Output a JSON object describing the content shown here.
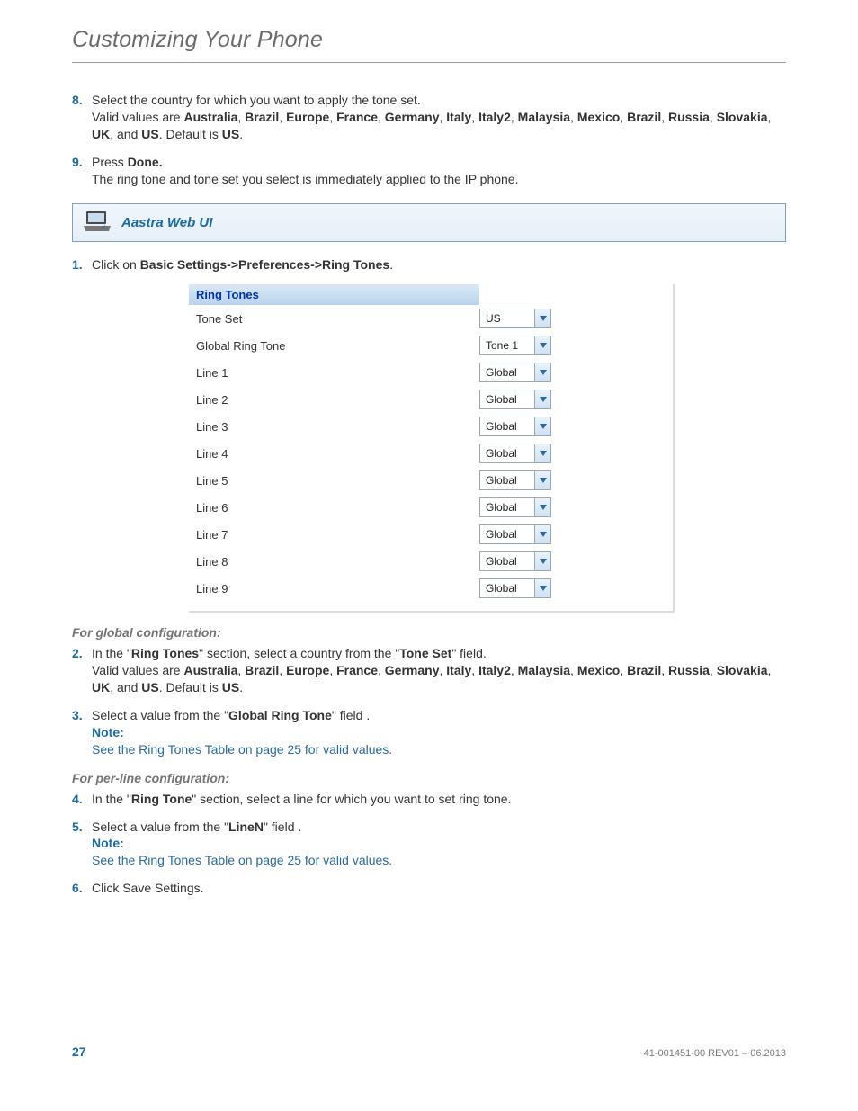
{
  "header": {
    "title": "Customizing Your Phone"
  },
  "topSteps": [
    {
      "num": "8.",
      "lead": "Select the country for which you want to apply the tone set.",
      "valid_prefix": "Valid values are ",
      "values": [
        "Australia",
        "Brazil",
        "Europe",
        "France",
        "Germany",
        "Italy",
        "Italy2",
        "Malaysia",
        "Mexico",
        "Brazil",
        "Russia",
        "Slovakia",
        "UK",
        "US"
      ],
      "valid_mid": ", and ",
      "valid_suffix": ". Default is ",
      "default": "US",
      "end": "."
    },
    {
      "num": "9.",
      "press_prefix": "Press ",
      "press_bold": "Done.",
      "after": "The ring tone and tone set you select is immediately applied to the IP phone."
    }
  ],
  "section": {
    "title": "Aastra Web UI"
  },
  "step1": {
    "num": "1.",
    "prefix": "Click on ",
    "bold": "Basic Settings->Preferences->Ring Tones",
    "suffix": "."
  },
  "ui": {
    "title": "Ring Tones",
    "rows": [
      {
        "label": "Tone Set",
        "value": "US"
      },
      {
        "label": "Global Ring Tone",
        "value": "Tone 1"
      },
      {
        "label": "Line 1",
        "value": "Global"
      },
      {
        "label": "Line 2",
        "value": "Global"
      },
      {
        "label": "Line 3",
        "value": "Global"
      },
      {
        "label": "Line 4",
        "value": "Global"
      },
      {
        "label": "Line 5",
        "value": "Global"
      },
      {
        "label": "Line 6",
        "value": "Global"
      },
      {
        "label": "Line 7",
        "value": "Global"
      },
      {
        "label": "Line 8",
        "value": "Global"
      },
      {
        "label": "Line 9",
        "value": "Global"
      }
    ]
  },
  "globalHeading": "For global configuration:",
  "step2": {
    "num": "2.",
    "t1": "In the \"",
    "b1": "Ring Tones",
    "t2": "\" section, select a country from the \"",
    "b2": "Tone Set",
    "t3": "\" field.",
    "valid_prefix": "Valid values are ",
    "values": [
      "Australia",
      "Brazil",
      "Europe",
      "France",
      "Germany",
      "Italy",
      "Italy2",
      "Malaysia",
      "Mexico",
      "Brazil",
      "Russia",
      "Slovakia",
      "UK",
      "US"
    ],
    "valid_mid": ", and ",
    "valid_suffix": ". Default is ",
    "default": "US",
    "end": "."
  },
  "step3": {
    "num": "3.",
    "t1": "Select a value from the \"",
    "b1": "Global Ring Tone",
    "t2": "\" field .",
    "note_label": "Note:",
    "note_t1": "See the ",
    "note_link": "Ring Tones Table",
    "note_t2": " on ",
    "note_page": "page 25",
    "note_t3": " for valid values."
  },
  "perLineHeading": "For per-line configuration:",
  "step4": {
    "num": "4.",
    "t1": "In the \"",
    "b1": "Ring Tone",
    "t2": "\" section, select a line for which you want to set ring tone."
  },
  "step5": {
    "num": "5.",
    "t1": "Select a value from the \"",
    "b1": "LineN",
    "t2": "\" field .",
    "note_label": "Note:",
    "note_t1": "See the ",
    "note_link": "Ring Tones Table",
    "note_t2": " on ",
    "note_page": "page 25",
    "note_t3": " for valid values."
  },
  "step6": {
    "num": "6.",
    "text": "Click Save Settings."
  },
  "footer": {
    "page": "27",
    "doc": "41-001451-00 REV01 – 06.2013"
  }
}
